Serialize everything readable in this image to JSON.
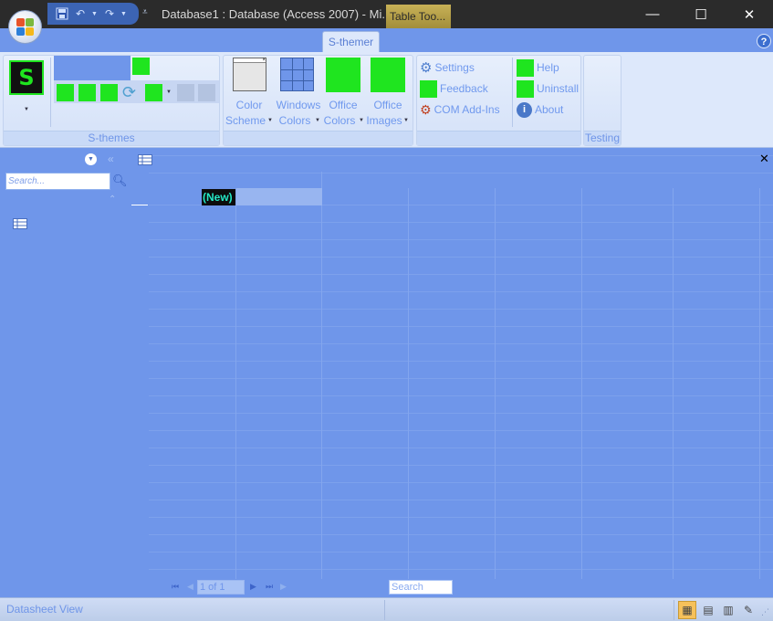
{
  "window": {
    "title": "Database1 : Database (Access 2007) - Mi...",
    "context_tab": "Table Too...",
    "minimize_glyph": "—",
    "maximize_glyph": "☐",
    "close_glyph": "✕"
  },
  "ribbon": {
    "active_tab": "S-themer",
    "help_glyph": "?",
    "groups": {
      "sthemes": {
        "label": "S-themes",
        "logo_letter": "S"
      },
      "colors": {
        "color_scheme_line1": "Color",
        "color_scheme_line2": "Scheme",
        "windows_colors_line1": "Windows",
        "windows_colors_line2": "Colors",
        "office_colors_line1": "Office",
        "office_colors_line2": "Colors",
        "office_images_line1": "Office",
        "office_images_line2": "Images"
      },
      "settings": {
        "settings": "Settings",
        "feedback": "Feedback",
        "com_addins": "COM Add-Ins",
        "help": "Help",
        "uninstall": "Uninstall",
        "about": "About"
      },
      "testing": {
        "label": "Testing"
      }
    }
  },
  "nav_pane": {
    "search_placeholder": "Search..."
  },
  "datasheet": {
    "new_record_label": "(New)"
  },
  "record_nav": {
    "record_position": "1 of 1",
    "search_placeholder": "Search"
  },
  "status_bar": {
    "view_label": "Datasheet View"
  },
  "colors": {
    "background": "#6f96ea",
    "ribbon": "#dde8fb",
    "green_swatch": "#1fe51f",
    "titlebar": "#2b2b2b",
    "context_tab": "#b59f47"
  },
  "icons": [
    "save-icon",
    "undo-icon",
    "redo-icon",
    "customize-icon",
    "help-icon",
    "refresh-icon",
    "gear-icon",
    "info-icon",
    "table-icon",
    "search-icon",
    "close-icon"
  ]
}
